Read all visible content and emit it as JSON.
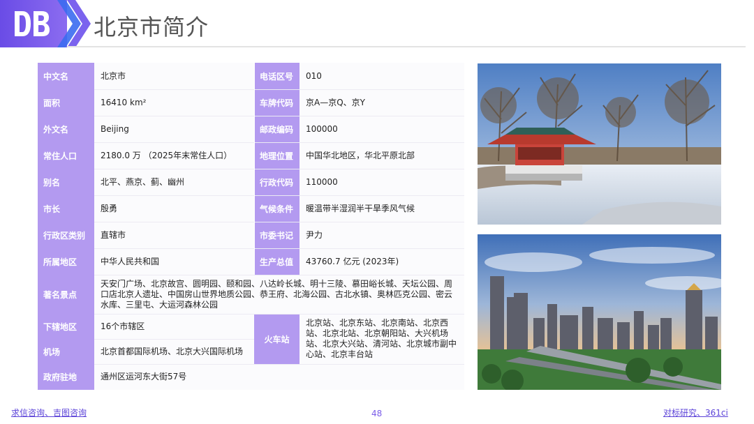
{
  "header": {
    "logo_text": "DB",
    "title": "北京市简介"
  },
  "rows": [
    {
      "label": "中文名",
      "value": "北京市"
    },
    {
      "label": "面积",
      "value": "16410 km²"
    },
    {
      "label": "外文名",
      "value": "Beijing"
    },
    {
      "label": "常住人口",
      "value": "2180.0 万 （2025年末常住人口）"
    },
    {
      "label": "别名",
      "value": "北平、燕京、蓟、幽州"
    },
    {
      "label": "市长",
      "value": "殷勇"
    },
    {
      "label": "行政区类别",
      "value": "直辖市"
    },
    {
      "label": "所属地区",
      "value": "中华人民共和国"
    },
    {
      "label": "著名景点",
      "value": "天安门广场、北京故宫、圆明园、颐和园、八达岭长城、明十三陵、慕田峪长城、天坛公园、周口店北京人遗址、中国房山世界地质公园、恭王府、北海公园、古北水镇、奥林匹克公园、密云水库、三里屯、大运河森林公园"
    },
    {
      "label": "下辖地区",
      "value": "16个市辖区"
    },
    {
      "label": "机场",
      "value": "北京首都国际机场、北京大兴国际机场"
    },
    {
      "label": "政府驻地",
      "value": "通州区运河东大街57号"
    }
  ],
  "rows_right": [
    {
      "label": "电话区号",
      "value": "010"
    },
    {
      "label": "车牌代码",
      "value": "京A—京Q、京Y"
    },
    {
      "label": "邮政编码",
      "value": "100000"
    },
    {
      "label": "地理位置",
      "value": "中国华北地区，华北平原北部"
    },
    {
      "label": "行政代码",
      "value": "110000"
    },
    {
      "label": "气候条件",
      "value": "暖温带半湿润半干旱季风气候"
    },
    {
      "label": "市委书记",
      "value": "尹力"
    },
    {
      "label": "生产总值",
      "value": "43760.7 亿元 (2023年)"
    },
    {
      "label": "火车站",
      "value": "北京站、北京东站、北京南站、北京西站、北京北站、北京朝阳站、大兴机场站、北京大兴站、清河站、北京城市副中心站、北京丰台站"
    }
  ],
  "footer": {
    "left_link": "求信咨询、吉图咨询",
    "page_number": "48",
    "right_link": "对标研究、361ci"
  },
  "colors": {
    "brand": "#6a4ce6",
    "label_bg": "#b39af0",
    "link": "#5b42d8"
  }
}
